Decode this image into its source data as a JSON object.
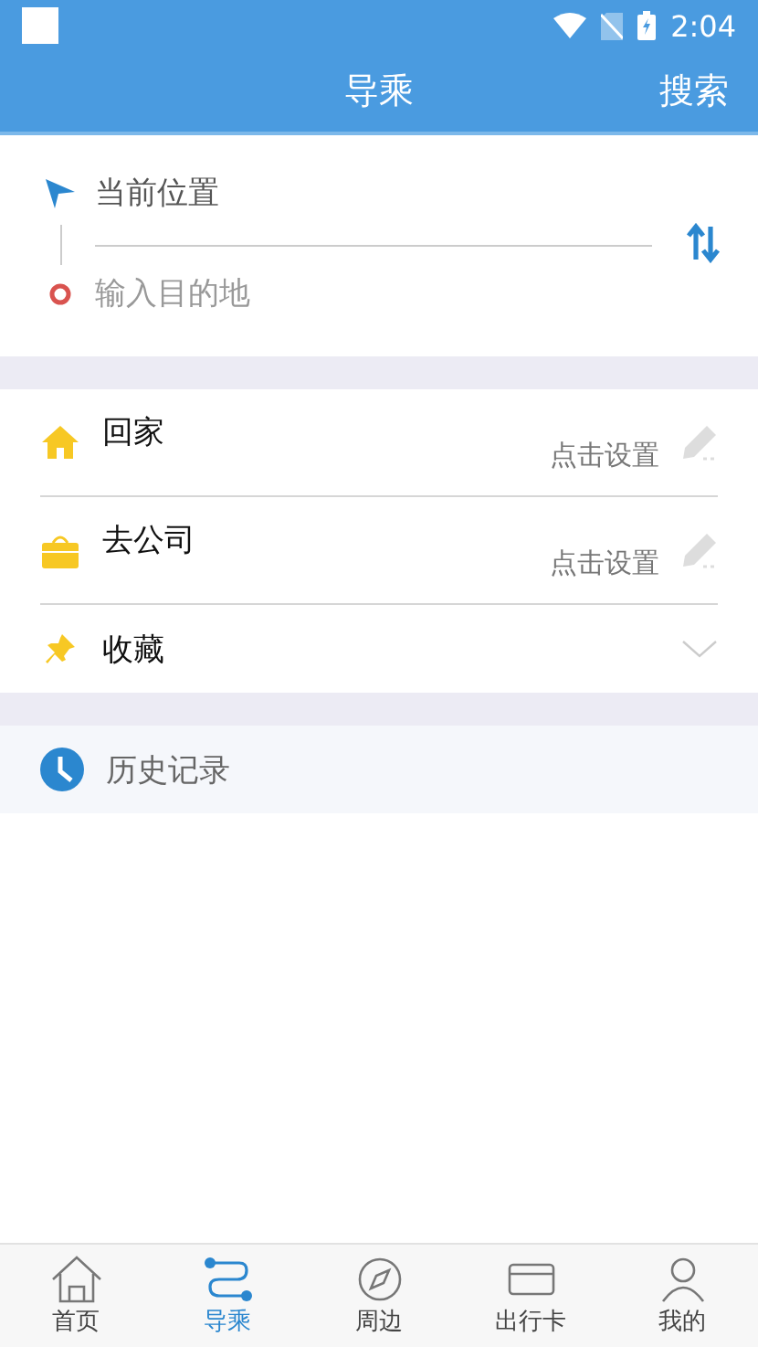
{
  "status_bar": {
    "time": "2:04"
  },
  "header": {
    "title": "导乘",
    "action": "搜索"
  },
  "route": {
    "origin": "当前位置",
    "destination_placeholder": "输入目的地"
  },
  "shortcuts": [
    {
      "kind": "home",
      "label": "回家",
      "hint": "点击设置"
    },
    {
      "kind": "work",
      "label": "去公司",
      "hint": "点击设置"
    },
    {
      "kind": "favorites",
      "label": "收藏"
    }
  ],
  "history": {
    "label": "历史记录"
  },
  "tab_bar": [
    {
      "kind": "home",
      "label": "首页",
      "selected": false
    },
    {
      "kind": "route",
      "label": "导乘",
      "selected": true
    },
    {
      "kind": "nearby",
      "label": "周边",
      "selected": false
    },
    {
      "kind": "card",
      "label": "出行卡",
      "selected": false
    },
    {
      "kind": "me",
      "label": "我的",
      "selected": false
    }
  ]
}
